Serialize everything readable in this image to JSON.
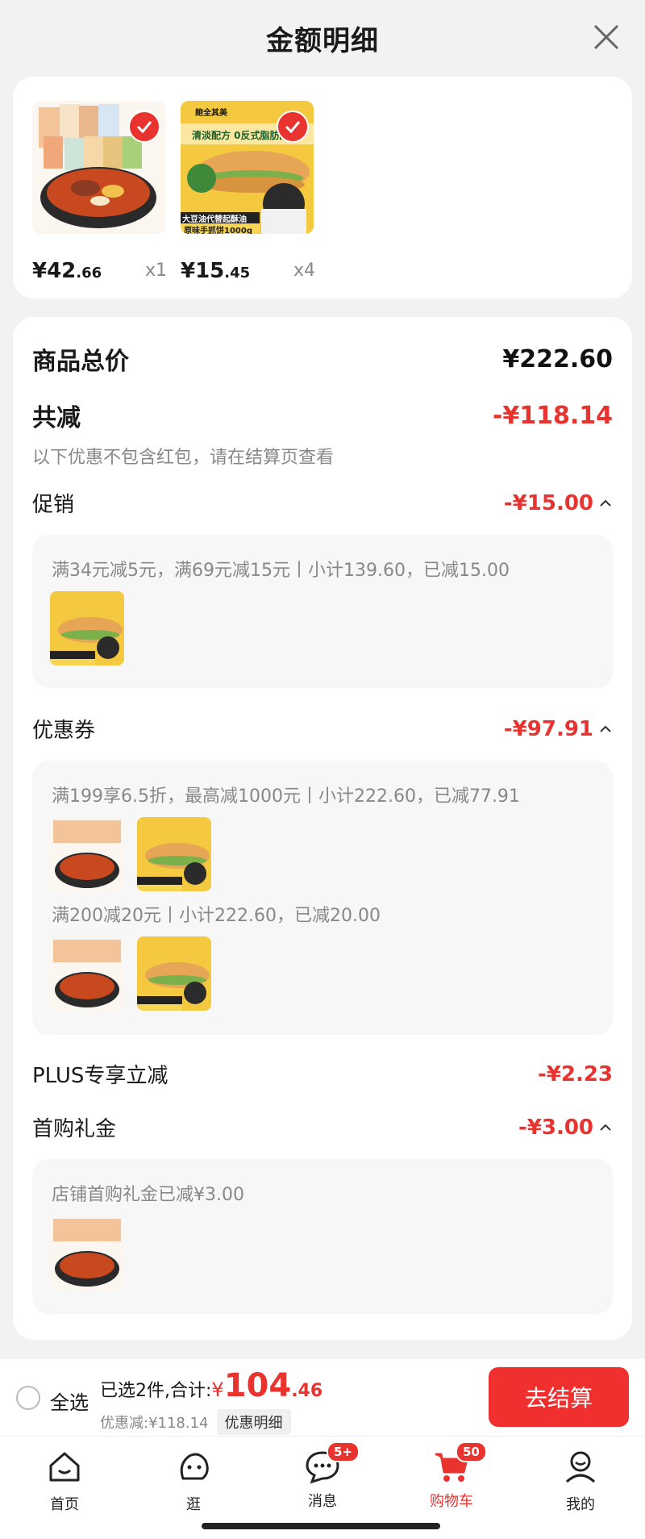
{
  "header": {
    "title": "金额明细"
  },
  "products": [
    {
      "price_main": "¥42",
      "price_dec": ".66",
      "qty": "x1",
      "image": "noodle-food-pack"
    },
    {
      "price_main": "¥15",
      "price_dec": ".45",
      "qty": "x4",
      "image": "pancake-pack",
      "banner": "清淡配方 0反式脂肪酸",
      "label1": "大豆油代替起酥油",
      "label2": "原味手抓饼1000g",
      "brand": "鲍全其美"
    }
  ],
  "summary": {
    "total_label": "商品总价",
    "total_value": "¥222.60",
    "reduce_label": "共减",
    "reduce_value": "-¥118.14",
    "note": "以下优惠不包含红包，请在结算页查看"
  },
  "promo": {
    "label": "促销",
    "value": "-¥15.00",
    "desc": "满34元减5元，满69元减15元丨小计139.60，已减15.00"
  },
  "coupon": {
    "label": "优惠券",
    "value": "-¥97.91",
    "desc1": "满199享6.5折，最高减1000元丨小计222.60，已减77.91",
    "desc2": "满200减20元丨小计222.60，已减20.00"
  },
  "plus": {
    "label": "PLUS专享立减",
    "value": "-¥2.23"
  },
  "firstbuy": {
    "label": "首购礼金",
    "value": "-¥3.00",
    "desc": "店铺首购礼金已减¥3.00"
  },
  "bottom": {
    "select_all": "全选",
    "selected_text": "已选2件,合计:",
    "currency": "¥",
    "amount": "104",
    "amount_dec": ".46",
    "discount_text": "优惠减:¥118.14",
    "detail_button": "优惠明细",
    "checkout": "去结算"
  },
  "tabs": [
    {
      "label": "首页",
      "icon": "home-icon"
    },
    {
      "label": "逛",
      "icon": "browse-icon"
    },
    {
      "label": "消息",
      "icon": "message-icon",
      "badge": "5+"
    },
    {
      "label": "购物车",
      "icon": "cart-icon",
      "badge": "50",
      "active": true
    },
    {
      "label": "我的",
      "icon": "profile-icon"
    }
  ],
  "colors": {
    "accent": "#e8332f",
    "background": "#f2f2f2"
  }
}
